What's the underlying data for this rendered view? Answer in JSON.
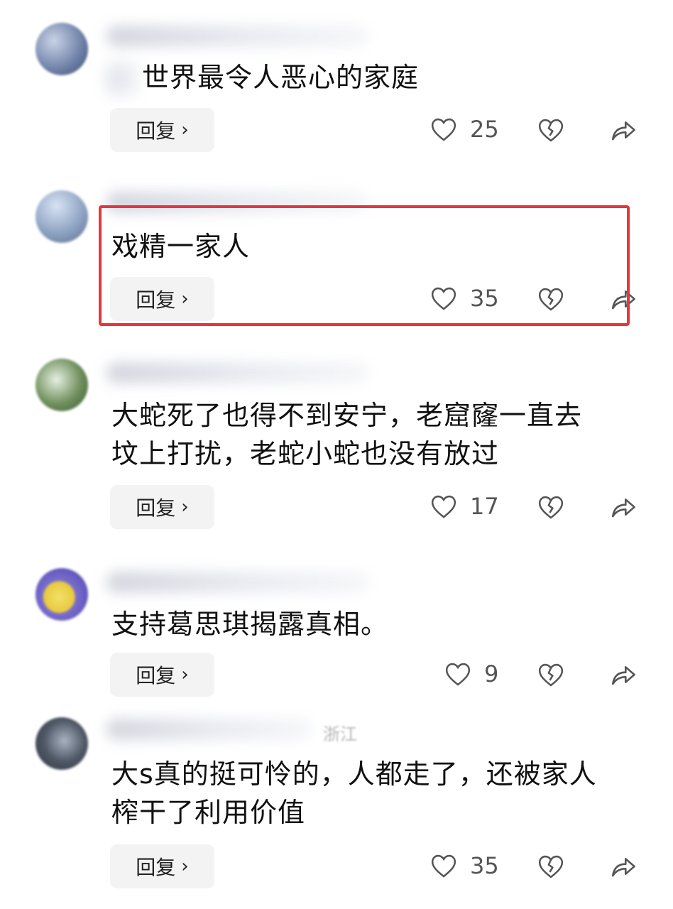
{
  "comments": [
    {
      "text": "世界最令人恶心的家庭",
      "reply_label": "回复",
      "likes": "25",
      "location": ""
    },
    {
      "text": "戏精一家人",
      "reply_label": "回复",
      "likes": "35",
      "location": ""
    },
    {
      "text_lines": [
        "大蛇死了也得不到安宁，老窟窿一直去",
        "坟上打扰，老蛇小蛇也没有放过"
      ],
      "reply_label": "回复",
      "likes": "17",
      "location": ""
    },
    {
      "text": "支持葛思琪揭露真相。",
      "reply_label": "回复",
      "likes": "9",
      "location": ""
    },
    {
      "text_lines": [
        "大s真的挺可怜的，人都走了，还被家人",
        "榨干了利用价值"
      ],
      "reply_label": "回复",
      "likes": "35",
      "location": "浙江"
    }
  ],
  "icons": {
    "like": "heart-icon",
    "dislike": "broken-heart-icon",
    "share": "share-arrow-icon",
    "reply_chevron": "chevron-right-icon"
  },
  "colors": {
    "highlight": "#e8353d",
    "reply_bg": "#f3f3f3"
  }
}
